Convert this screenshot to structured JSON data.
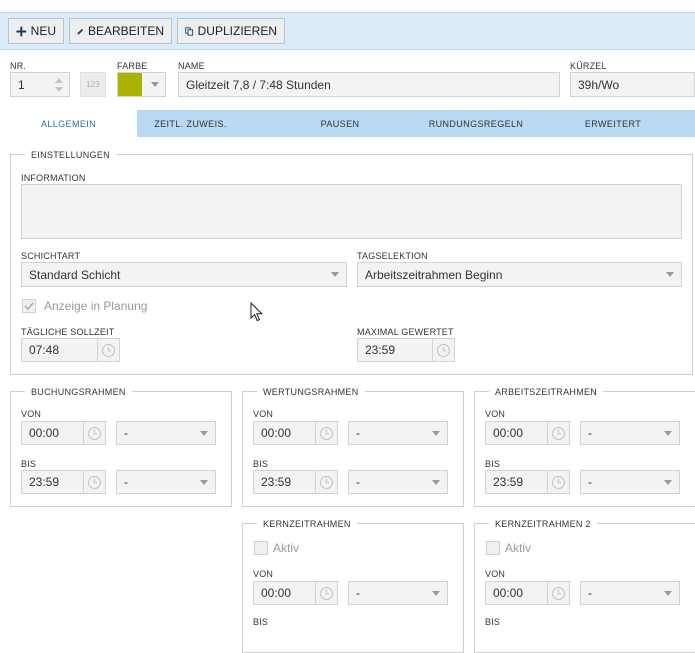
{
  "toolbar": {
    "new_label": "NEU",
    "edit_label": "BEARBEITEN",
    "duplicate_label": "DUPLIZIEREN"
  },
  "header": {
    "nr_label": "NR.",
    "nr_value": "1",
    "nr_format_hint": "123",
    "color_label": "FARBE",
    "color_value": "#a9b400",
    "name_label": "NAME",
    "name_value": "Gleitzeit 7,8 / 7:48 Stunden",
    "short_label": "KÜRZEL",
    "short_value": "39h/Wo"
  },
  "tabs": [
    {
      "label": "ALLGEMEIN",
      "active": true
    },
    {
      "label": "ZEITL. ZUWEIS.",
      "active": false
    },
    {
      "label": "PAUSEN",
      "active": false
    },
    {
      "label": "RUNDUNGSREGELN",
      "active": false
    },
    {
      "label": "ERWEITERT",
      "active": false
    }
  ],
  "settings": {
    "title": "EINSTELLUNGEN",
    "info_label": "INFORMATION",
    "info_value": "",
    "shift_type_label": "SCHICHTART",
    "shift_type_value": "Standard Schicht",
    "day_selection_label": "TAGSELEKTION",
    "day_selection_value": "Arbeitszeitrahmen Beginn",
    "show_in_planning_label": "Anzeige in Planung",
    "show_in_planning_checked": true,
    "daily_target_label": "TÄGLICHE SOLLZEIT",
    "daily_target_value": "07:48",
    "max_rated_label": "MAXIMAL GEWERTET",
    "max_rated_value": "23:59"
  },
  "frames": {
    "booking": {
      "title": "BUCHUNGSRAHMEN",
      "from_label": "VON",
      "from_value": "00:00",
      "from_select": "-",
      "to_label": "BIS",
      "to_value": "23:59",
      "to_select": "-"
    },
    "rating": {
      "title": "WERTUNGSRAHMEN",
      "from_label": "VON",
      "from_value": "00:00",
      "from_select": "-",
      "to_label": "BIS",
      "to_value": "23:59",
      "to_select": "-"
    },
    "working": {
      "title": "ARBEITSZEITRAHMEN",
      "from_label": "VON",
      "from_value": "00:00",
      "from_select": "-",
      "to_label": "BIS",
      "to_value": "23:59",
      "to_select": "-"
    },
    "core": {
      "title": "KERNZEITRAHMEN",
      "active_label": "Aktiv",
      "from_label": "VON",
      "from_value": "00:00",
      "from_select": "-",
      "to_label": "BIS"
    },
    "core2": {
      "title": "KERNZEITRAHMEN 2",
      "active_label": "Aktiv",
      "from_label": "VON",
      "from_value": "00:00",
      "from_select": "-",
      "to_label": "BIS"
    }
  },
  "cursor": "arrow-cursor-icon"
}
